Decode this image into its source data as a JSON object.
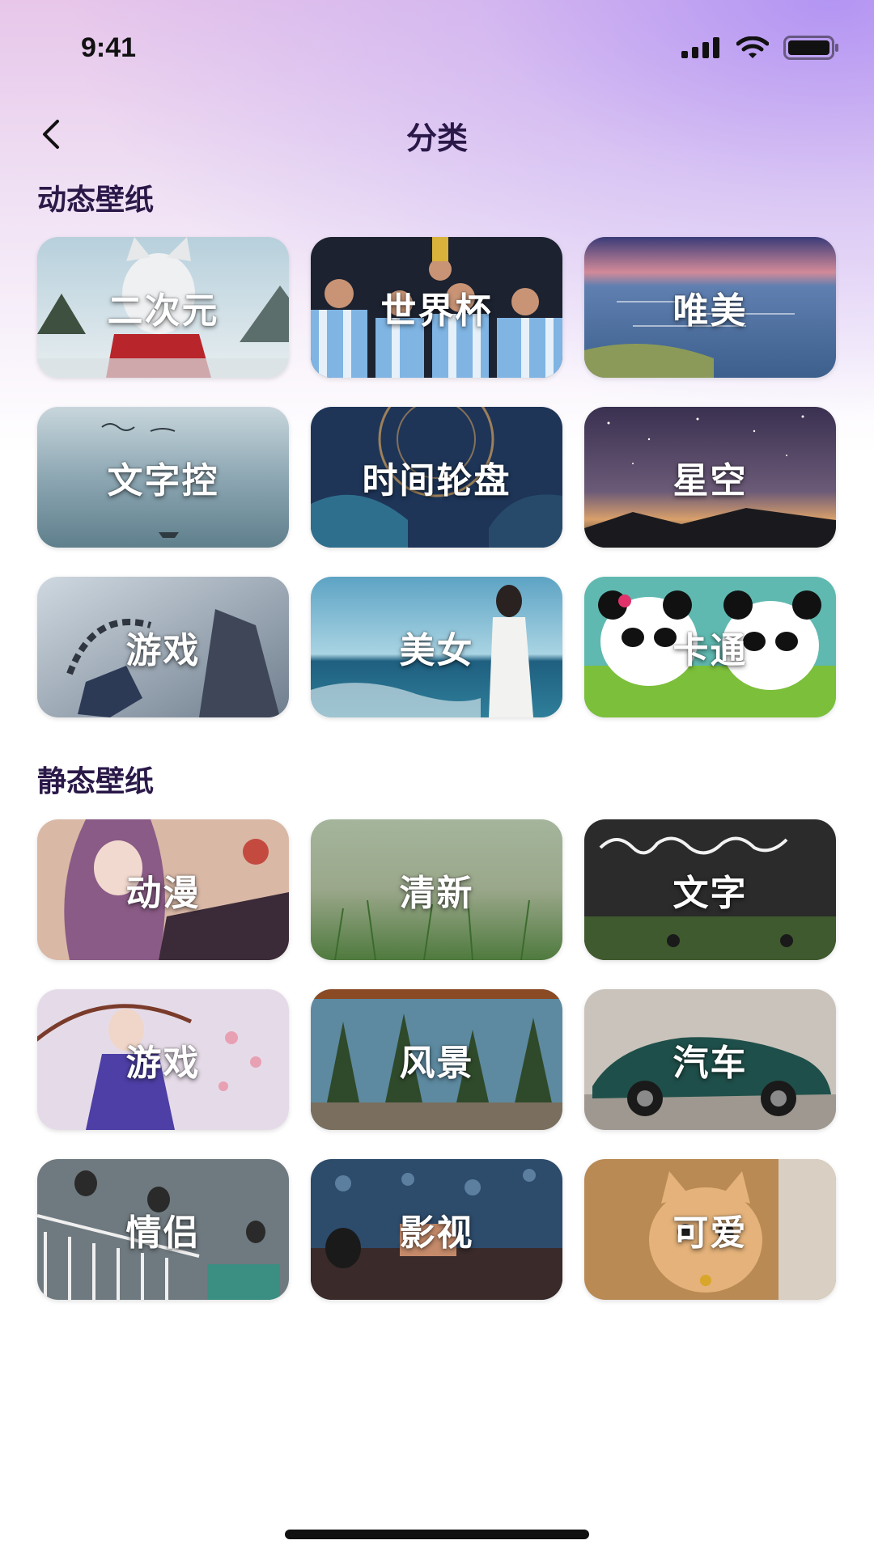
{
  "status_bar": {
    "time": "9:41"
  },
  "header": {
    "title": "分类"
  },
  "sections": [
    {
      "title": "动态壁纸",
      "items": [
        {
          "label": "二次元",
          "icon": "anime-girl-cat-ears"
        },
        {
          "label": "世界杯",
          "icon": "football-team-trophy"
        },
        {
          "label": "唯美",
          "icon": "sunset-lake"
        },
        {
          "label": "文字控",
          "icon": "handwritten-sea"
        },
        {
          "label": "时间轮盘",
          "icon": "clock-wheel"
        },
        {
          "label": "星空",
          "icon": "starry-sky"
        },
        {
          "label": "游戏",
          "icon": "game-warrior-chain"
        },
        {
          "label": "美女",
          "icon": "woman-seaside"
        },
        {
          "label": "卡通",
          "icon": "cartoon-pandas"
        }
      ]
    },
    {
      "title": "静态壁纸",
      "items": [
        {
          "label": "动漫",
          "icon": "anime-girl-purple-hair"
        },
        {
          "label": "清新",
          "icon": "fresh-grass"
        },
        {
          "label": "文字",
          "icon": "calligraphy-park"
        },
        {
          "label": "游戏",
          "icon": "game-umbrella-girl"
        },
        {
          "label": "风景",
          "icon": "forest-landscape"
        },
        {
          "label": "汽车",
          "icon": "green-sports-car"
        },
        {
          "label": "情侣",
          "icon": "couple-balcony"
        },
        {
          "label": "影视",
          "icon": "film-scene-diner"
        },
        {
          "label": "可爱",
          "icon": "cute-cat"
        }
      ]
    }
  ]
}
